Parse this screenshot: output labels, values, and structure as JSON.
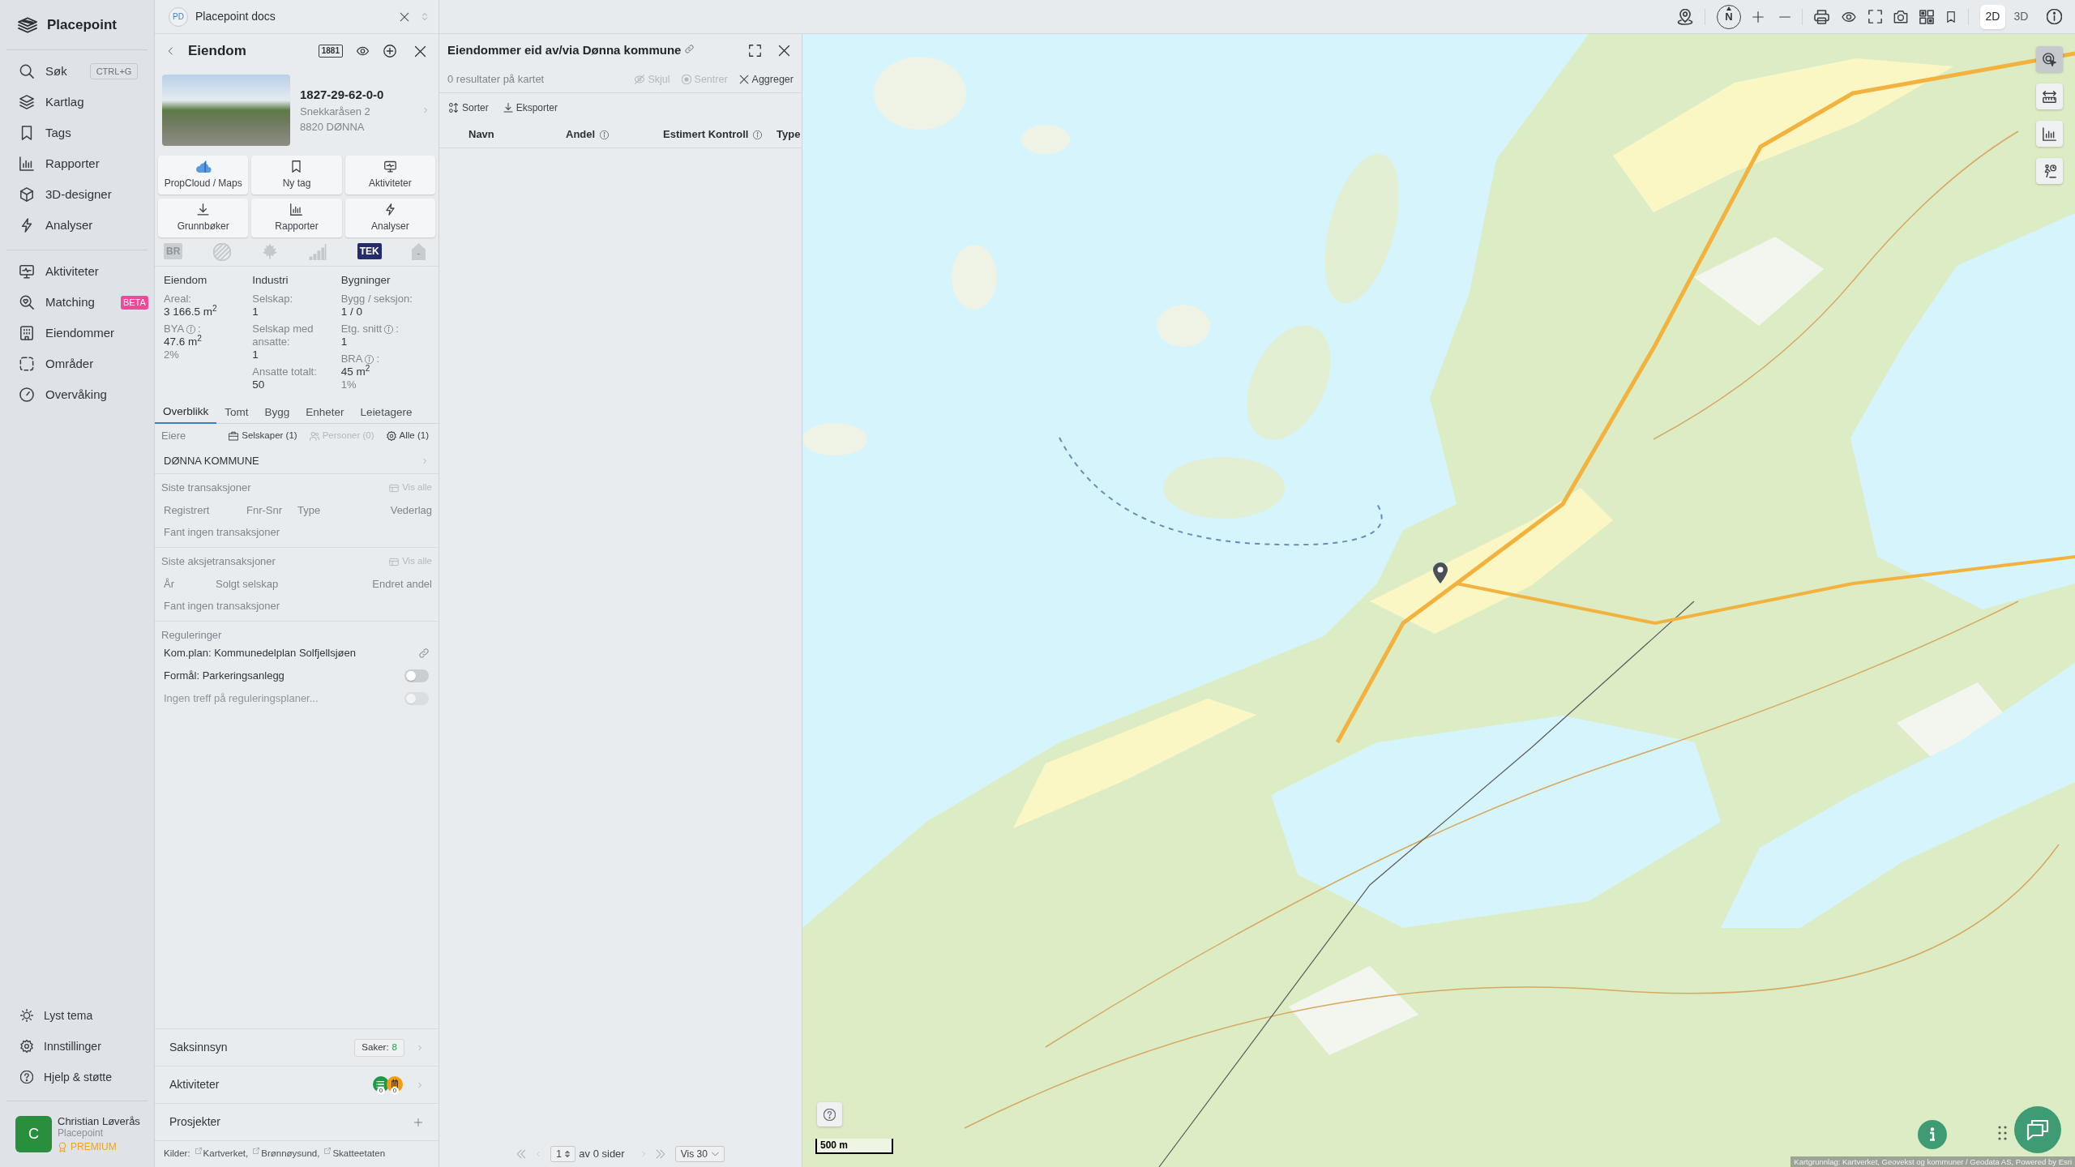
{
  "sidebar": {
    "app_name": "Placepoint",
    "nav_groups": [
      [
        {
          "label": "Søk",
          "shortcut": "CTRL+G",
          "selected": false
        },
        {
          "label": "Kartlag",
          "selected": false
        },
        {
          "label": "Tags",
          "selected": false
        },
        {
          "label": "Rapporter",
          "selected": false
        },
        {
          "label": "3D-designer",
          "selected": false
        },
        {
          "label": "Analyser",
          "selected": false
        }
      ],
      [
        {
          "label": "Aktiviteter",
          "selected": false
        },
        {
          "label": "Matching",
          "badge": "BETA",
          "selected": false
        },
        {
          "label": "Eiendommer",
          "selected": false
        },
        {
          "label": "Områder",
          "selected": false
        },
        {
          "label": "Overvåking",
          "selected": false
        }
      ]
    ],
    "bottom_items": [
      {
        "label": "Lyst tema"
      },
      {
        "label": "Innstillinger"
      },
      {
        "label": "Hjelp & støtte"
      }
    ],
    "user": {
      "initial": "C",
      "name": "Christian Løverås",
      "organization": "Placepoint",
      "plan": "PREMIUM"
    }
  },
  "workspace": {
    "badge": "PD",
    "title": "Placepoint docs"
  },
  "property_panel": {
    "title": "Eiendom",
    "badge": "1881",
    "property_id": "1827-29-62-0-0",
    "address": "Snekkaråsen 2",
    "postal": "8820 DØNNA",
    "actions": [
      {
        "label": "PropCloud / Maps"
      },
      {
        "label": "Ny tag"
      },
      {
        "label": "Aktiviteter"
      },
      {
        "label": "Grunnbøker"
      },
      {
        "label": "Rapporter"
      },
      {
        "label": "Analyser"
      }
    ],
    "sources": [
      {
        "label": "BR",
        "disabled": true
      },
      {
        "disabled": true
      },
      {
        "disabled": true
      },
      {
        "disabled": true
      },
      {
        "label": "TEK",
        "disabled": false
      },
      {
        "label": "-",
        "disabled": true
      }
    ],
    "stats": [
      {
        "heading": "Eiendom",
        "fields": [
          {
            "label": "Areal:",
            "info": false,
            "value": "3 166.5 m$^{2}$"
          },
          {
            "label": "BYA",
            "info": true,
            "suffix": ":",
            "value": "47.6 m$^{2}$",
            "note": "2%"
          }
        ]
      },
      {
        "heading": "Industri",
        "fields": [
          {
            "label": "Selskap:",
            "info": false,
            "value": "1"
          },
          {
            "label": "Selskap med ansatte:",
            "info": false,
            "value": "1"
          },
          {
            "label": "Ansatte totalt:",
            "info": false,
            "value": "50"
          }
        ]
      },
      {
        "heading": "Bygninger",
        "fields": [
          {
            "label": "Bygg / seksjon:",
            "info": false,
            "value": "1 / 0"
          },
          {
            "label": "Etg. snitt",
            "info": true,
            "suffix": ":",
            "value": "1"
          },
          {
            "label": "BRA",
            "info": true,
            "suffix": ":",
            "value": "45 m$^{2}$",
            "note": "1%"
          }
        ]
      }
    ],
    "tabs": [
      {
        "label": "Overblikk",
        "selected": true
      },
      {
        "label": "Tomt",
        "selected": false
      },
      {
        "label": "Bygg",
        "selected": false
      },
      {
        "label": "Enheter",
        "selected": false
      },
      {
        "label": "Leietagere",
        "selected": false
      }
    ],
    "owners": {
      "label": "Eiere",
      "filters": [
        {
          "label": "Selskaper (1)",
          "disabled": false
        },
        {
          "label": "Personer (0)",
          "disabled": true
        },
        {
          "label": "Alle (1)",
          "disabled": false
        }
      ],
      "rows": [
        "DØNNA KOMMUNE"
      ]
    },
    "transactions": {
      "title": "Siste transaksjoner",
      "action": {
        "label": "Vis alle",
        "disabled": true
      },
      "columns": [
        "Registrert",
        "Fnr-Snr",
        "Type",
        "Vederlag"
      ],
      "empty": "Fant ingen transaksjoner"
    },
    "share_transactions": {
      "title": "Siste aksjetransaksjoner",
      "action": {
        "label": "Vis alle",
        "disabled": true
      },
      "columns": [
        "År",
        "Solgt selskap",
        "Endret andel"
      ],
      "empty": "Fant ingen transaksjoner"
    },
    "regulations": {
      "title": "Reguleringer",
      "items": [
        {
          "kind": "link",
          "text": "Kom.plan: Kommunedelplan Solfjellsjøen"
        },
        {
          "kind": "toggle",
          "text": "Formål: Parkeringsanlegg",
          "on": false,
          "disabled": false
        },
        {
          "kind": "toggle",
          "text": "Ingen treff på reguleringsplaner...",
          "on": false,
          "disabled": true
        }
      ]
    },
    "sections": [
      {
        "kind": "count",
        "label": "Saksinnsyn",
        "badge_label": "Saker:",
        "badge_value": "8"
      },
      {
        "kind": "activities",
        "label": "Aktiviteter",
        "counts": [
          {
            "value": "0",
            "color": "#1e9a47"
          },
          {
            "value": "0",
            "color": "#f39c12"
          }
        ]
      },
      {
        "kind": "add",
        "label": "Prosjekter"
      }
    ],
    "sources_footer": {
      "label": "Kilder:",
      "links": [
        "Kartverket,",
        "Brønnøysund,",
        "Skatteetaten"
      ]
    }
  },
  "results_panel": {
    "title": "Eiendommer eid av/via Dønna kommune",
    "summary": "0 resultater på kartet",
    "actions": [
      {
        "label": "Skjul",
        "disabled": true
      },
      {
        "label": "Sentrer",
        "disabled": true
      },
      {
        "label": "Aggreger",
        "disabled": false
      }
    ],
    "tools": [
      "Sorter",
      "Eksporter"
    ],
    "columns": [
      {
        "label": "Navn",
        "info": false
      },
      {
        "label": "Andel",
        "info": true
      },
      {
        "label": "Estimert Kontroll",
        "info": true
      },
      {
        "label": "Type",
        "info": false
      }
    ],
    "pagination": {
      "page": "1",
      "pages_label": "av 0 sider",
      "page_size": "Vis 30"
    }
  },
  "map": {
    "toolbar": {
      "compass": "N",
      "modes": [
        {
          "label": "2D",
          "selected": true
        },
        {
          "label": "3D",
          "selected": false
        }
      ]
    },
    "side_tools": [
      {
        "selected": true
      },
      {
        "selected": false
      },
      {
        "selected": false
      },
      {
        "selected": false
      }
    ],
    "scale": "500 m",
    "attribution": "Kartgrunnlag: Kartverket, Geovekst og kommuner / Geodata AS, Powered by Esri"
  }
}
